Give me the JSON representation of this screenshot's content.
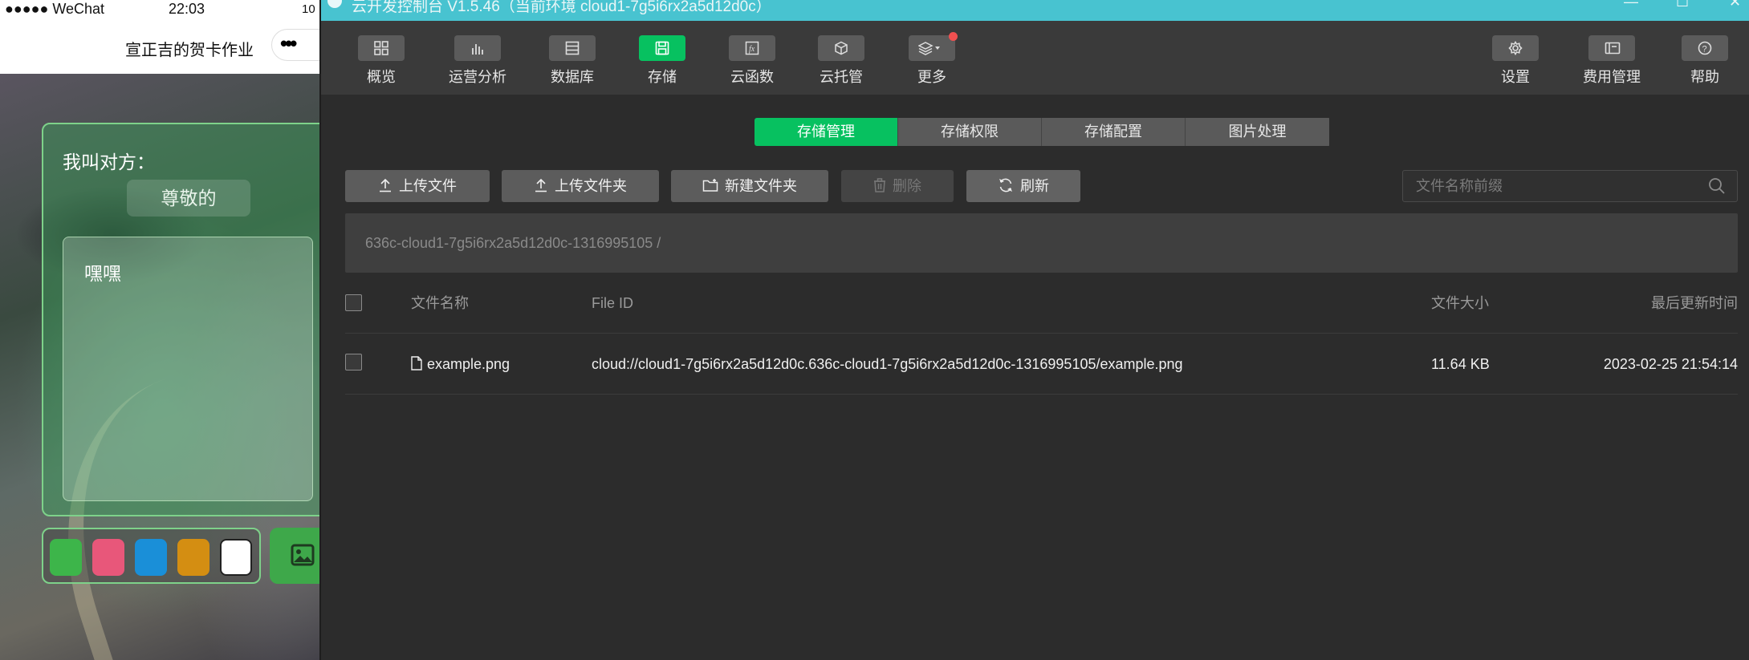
{
  "phone": {
    "status": {
      "carrier": "●●●●● WeChat",
      "time": "22:03",
      "battery": "10"
    },
    "nav_title": "宣正吉的贺卡作业",
    "nav_menu": "•••",
    "card": {
      "label": "我叫对方：",
      "salutation": "尊敬的",
      "message": "嘿嘿"
    },
    "swatches": [
      {
        "name": "green",
        "color": "#3db54a"
      },
      {
        "name": "pink",
        "color": "#e8577a"
      },
      {
        "name": "blue",
        "color": "#1a8fd8"
      },
      {
        "name": "amber",
        "color": "#d48e12"
      },
      {
        "name": "white",
        "color": "#ffffff"
      }
    ]
  },
  "console": {
    "title": "云开发控制台 V1.5.46（当前环境 cloud1-7g5i6rx2a5d12d0c）",
    "window_controls": {
      "minimize": "—",
      "maximize": "☐",
      "close": "✕"
    },
    "toolbar": {
      "overview": "概览",
      "analytics": "运营分析",
      "database": "数据库",
      "storage": "存储",
      "functions": "云函数",
      "hosting": "云托管",
      "more": "更多",
      "settings": "设置",
      "billing": "费用管理",
      "help": "帮助"
    },
    "tabs": [
      "存储管理",
      "存储权限",
      "存储配置",
      "图片处理"
    ],
    "actions": {
      "upload_file": "上传文件",
      "upload_folder": "上传文件夹",
      "new_folder": "新建文件夹",
      "delete": "删除",
      "refresh": "刷新"
    },
    "search": {
      "placeholder": "文件名称前缀"
    },
    "breadcrumb": "636c-cloud1-7g5i6rx2a5d12d0c-1316995105  /",
    "table": {
      "headers": {
        "name": "文件名称",
        "file_id": "File ID",
        "size": "文件大小",
        "updated": "最后更新时间"
      },
      "rows": [
        {
          "name": "example.png",
          "file_id": "cloud://cloud1-7g5i6rx2a5d12d0c.636c-cloud1-7g5i6rx2a5d12d0c-1316995105/example.png",
          "size": "11.64 KB",
          "updated": "2023-02-25 21:54:14"
        }
      ]
    }
  }
}
